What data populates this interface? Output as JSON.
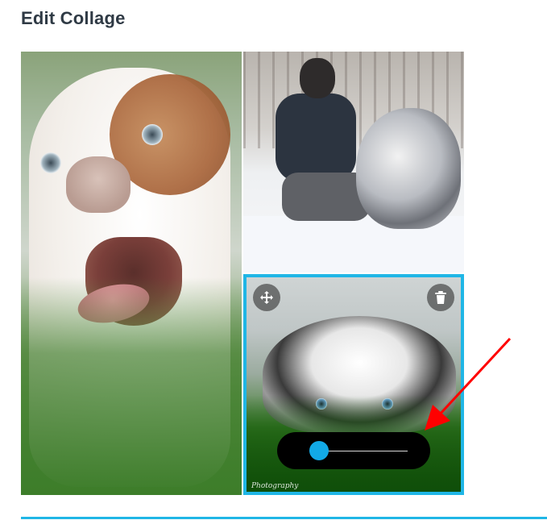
{
  "page": {
    "title": "Edit Collage"
  },
  "collage": {
    "photos": [
      {
        "name": "bulldog-photo",
        "position": "left"
      },
      {
        "name": "man-dog-snow-photo",
        "position": "top-right"
      },
      {
        "name": "aussie-grass-photo",
        "position": "bottom-right",
        "selected": true,
        "watermark": "Photography"
      }
    ],
    "selected_photo_tools": {
      "move_icon": "move-arrows-icon",
      "delete_icon": "trash-icon"
    },
    "zoom": {
      "value": 0.1
    }
  },
  "annotation": {
    "arrow_color": "#ff0000",
    "accent": "#1fb6e6"
  }
}
